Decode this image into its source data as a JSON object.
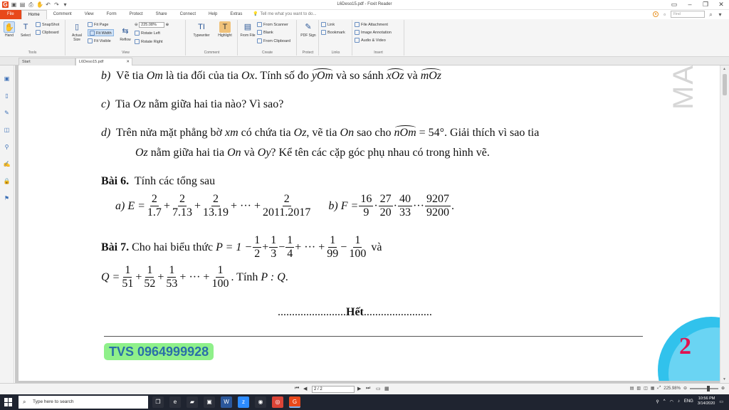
{
  "window": {
    "title": "L6Deso15.pdf - Foxit Reader"
  },
  "menu_tabs": [
    "File",
    "Home",
    "Comment",
    "View",
    "Form",
    "Protect",
    "Share",
    "Connect",
    "Help",
    "Extras"
  ],
  "tell_me": "Tell me what you want to do...",
  "find_placeholder": "Find",
  "ribbon": {
    "tools": {
      "label": "Tools",
      "hand": "Hand",
      "select": "Select",
      "snapshot": "SnapShot",
      "clipboard": "Clipboard"
    },
    "view": {
      "label": "View",
      "actual_size": "Actual Size",
      "fit_page": "Fit Page",
      "fit_width": "Fit Width",
      "fit_visible": "Fit Visible",
      "zoom": "225.08%",
      "reflow": "Reflow",
      "rotate_left": "Rotate Left",
      "rotate_right": "Rotate Right"
    },
    "comment": {
      "label": "Comment",
      "typewriter": "Typewriter",
      "highlight": "Highlight"
    },
    "create": {
      "label": "Create",
      "from_file": "From File",
      "from_scanner": "From Scanner",
      "blank": "Blank",
      "from_clipboard": "From Clipboard"
    },
    "protect": {
      "label": "Protect",
      "pdf_sign": "PDF Sign"
    },
    "links": {
      "label": "Links",
      "link": "Link",
      "bookmark": "Bookmark"
    },
    "insert": {
      "label": "Insert",
      "file_attachment": "File Attachment",
      "image_annotation": "Image Annotation",
      "audio_video": "Audio & Video"
    }
  },
  "doc_tabs": [
    "Start",
    "L6Deso15.pdf"
  ],
  "doc": {
    "b_label": "b)",
    "b_t1": "Vẽ tia",
    "b_om": "Om",
    "b_t2": "là tia đối của tia",
    "b_ox": "Ox",
    "b_t3": ". Tính số đo",
    "b_yom": "yOm",
    "b_t4": "và so sánh",
    "b_xoz": "xOz",
    "b_t5": "và",
    "b_moz": "mOz",
    "c_label": "c)",
    "c_t1": "Tia",
    "c_oz": "Oz",
    "c_t2": "nằm giữa hai tia nào? Vì sao?",
    "d_label": "d)",
    "d_t1": "Trên nửa mặt phẳng bờ",
    "d_xm": "xm",
    "d_t2": "có chứa tia",
    "d_oz": "Oz",
    "d_t3": ", vẽ tia",
    "d_on": "On",
    "d_t4": "sao cho",
    "d_nom": "nOm",
    "d_eq": "= 54°. Giải thích vì sao tia",
    "d2_oz": "Oz",
    "d2_t1": "nằm giữa hai tia",
    "d2_on": "On",
    "d2_t2": "và",
    "d2_oy": "Oy",
    "d2_t3": "? Kể tên các cặp góc phụ nhau có trong hình vẽ.",
    "bai6_title": "Bài 6.",
    "bai6_text": "Tính các tổng sau",
    "a_label": "a)",
    "e_lhs": "E =",
    "e_fracs": [
      [
        "2",
        "1.7"
      ],
      [
        "2",
        "7.13"
      ],
      [
        "2",
        "13.19"
      ]
    ],
    "e_dots": "+ ··· +",
    "e_last": [
      "2",
      "2011.2017"
    ],
    "f_label": "b)",
    "f_lhs": "F =",
    "f_fracs": [
      [
        "16",
        "9"
      ],
      [
        "27",
        "20"
      ],
      [
        "40",
        "33"
      ]
    ],
    "f_dots": "···",
    "f_last": [
      "9207",
      "9200"
    ],
    "bai7_title": "Bài 7.",
    "bai7_text": "Cho hai biểu thức",
    "p_lhs": "P = 1 −",
    "p_fracs": [
      [
        "1",
        "2"
      ],
      [
        "1",
        "3"
      ],
      [
        "1",
        "4"
      ]
    ],
    "p_dots": "+ ··· +",
    "p_f99": [
      "1",
      "99"
    ],
    "p_f100": [
      "1",
      "100"
    ],
    "p_va": "và",
    "q_lhs": "Q =",
    "q_fracs": [
      [
        "1",
        "51"
      ],
      [
        "1",
        "52"
      ],
      [
        "1",
        "53"
      ]
    ],
    "q_dots": "+ ··· +",
    "q_last": [
      "1",
      "100"
    ],
    "q_tail": ". Tính",
    "q_pq": "P : Q",
    "q_dot": ".",
    "het_left": "........................",
    "het": "Hết",
    "het_right": "........................",
    "watermark": "MA",
    "phone": "TVS 0964999928",
    "page_number": "2"
  },
  "status": {
    "page_box": "2 / 2",
    "zoom": "225.98%"
  },
  "taskbar": {
    "search_placeholder": "Type here to search",
    "lang": "ENG",
    "time": "10:56 PM",
    "date": "3/14/2020"
  },
  "colors": {
    "accent": "#e8481b",
    "phone_bg": "#8ff08a",
    "page_circle": "#31c2ec",
    "page_number": "#e0124f"
  }
}
